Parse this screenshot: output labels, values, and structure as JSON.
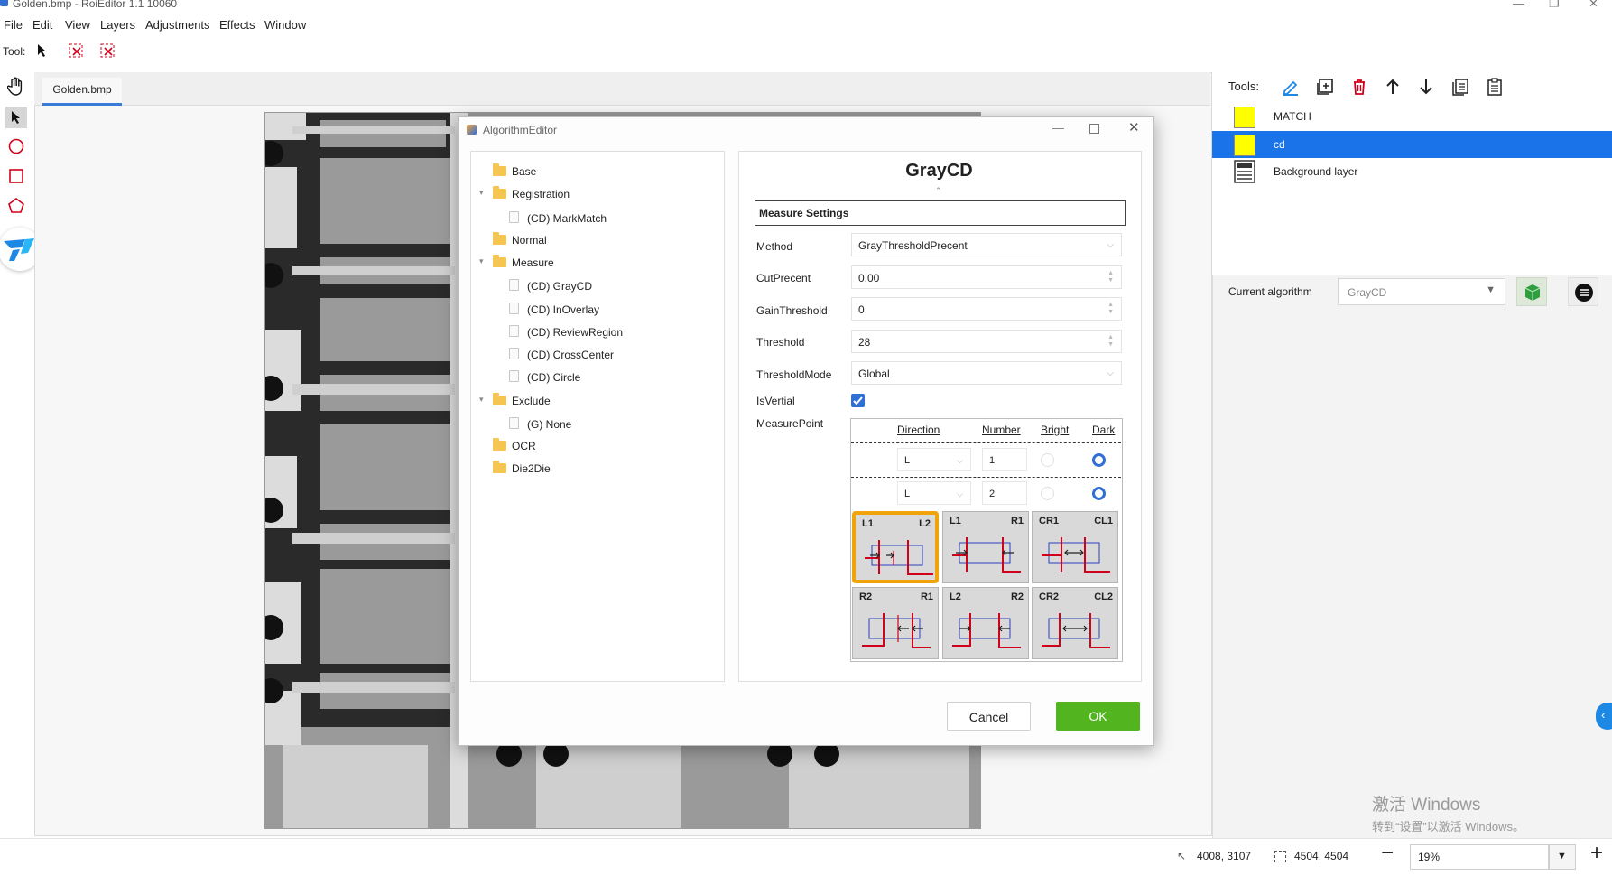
{
  "window": {
    "title": "Golden.bmp - RoiEditor 1.1 10060"
  },
  "menu": [
    "File",
    "Edit",
    "View",
    "Layers",
    "Adjustments",
    "Effects",
    "Window"
  ],
  "toolrow": {
    "label": "Tool:"
  },
  "document_tab": "Golden.bmp",
  "right_panel": {
    "tools_label": "Tools:",
    "layers": [
      {
        "name": "MATCH",
        "color": "#ffff00",
        "selected": false
      },
      {
        "name": "cd",
        "color": "#ffff00",
        "selected": true
      },
      {
        "name": "Background layer",
        "color": "",
        "selected": false
      }
    ],
    "current_algorithm_label": "Current algorithm",
    "current_algorithm_value": "GrayCD",
    "selection_color": "#1a73e8"
  },
  "watermark": {
    "line1": "激活 Windows",
    "line2": "转到“设置”以激活 Windows。"
  },
  "status": {
    "cursor": "4008, 3107",
    "size": "4504, 4504",
    "zoom": "19%"
  },
  "dialog": {
    "title": "AlgorithmEditor",
    "tree": [
      {
        "label": "Base",
        "type": "folder",
        "level": 0
      },
      {
        "label": "Registration",
        "type": "folder",
        "level": 0,
        "expanded": true
      },
      {
        "label": "(CD) MarkMatch",
        "type": "item",
        "level": 1
      },
      {
        "label": "Normal",
        "type": "folder",
        "level": 0
      },
      {
        "label": "Measure",
        "type": "folder",
        "level": 0,
        "expanded": true
      },
      {
        "label": "(CD) GrayCD",
        "type": "item",
        "level": 1
      },
      {
        "label": "(CD) InOverlay",
        "type": "item",
        "level": 1
      },
      {
        "label": "(CD) ReviewRegion",
        "type": "item",
        "level": 1
      },
      {
        "label": "(CD) CrossCenter",
        "type": "item",
        "level": 1
      },
      {
        "label": "(CD) Circle",
        "type": "item",
        "level": 1
      },
      {
        "label": "Exclude",
        "type": "folder",
        "level": 0,
        "expanded": true
      },
      {
        "label": "(G) None",
        "type": "item",
        "level": 1
      },
      {
        "label": "OCR",
        "type": "folder",
        "level": 0
      },
      {
        "label": "Die2Die",
        "type": "folder",
        "level": 0
      }
    ],
    "panel_title": "GrayCD",
    "section": "Measure Settings",
    "props": {
      "method": {
        "label": "Method",
        "value": "GrayThresholdPrecent"
      },
      "cutprecent": {
        "label": "CutPrecent",
        "value": "0.00"
      },
      "gainthreshold": {
        "label": "GainThreshold",
        "value": "0"
      },
      "threshold": {
        "label": "Threshold",
        "value": "28"
      },
      "thresholdmode": {
        "label": "ThresholdMode",
        "value": "Global"
      },
      "isvertial": {
        "label": "IsVertial",
        "checked": true
      },
      "measurepoint": {
        "label": "MeasurePoint"
      }
    },
    "measure_table": {
      "headers": [
        "Direction",
        "Number",
        "Bright",
        "Dark"
      ],
      "rows": [
        {
          "direction": "L",
          "number": "1",
          "bright": false,
          "dark": true
        },
        {
          "direction": "L",
          "number": "2",
          "bright": false,
          "dark": true
        }
      ]
    },
    "modes": [
      {
        "left": "L1",
        "right": "L2",
        "selected": true
      },
      {
        "left": "L1",
        "right": "R1",
        "selected": false
      },
      {
        "left": "CR1",
        "right": "CL1",
        "selected": false
      },
      {
        "left": "R2",
        "right": "R1",
        "selected": false
      },
      {
        "left": "L2",
        "right": "R2",
        "selected": false
      },
      {
        "left": "CR2",
        "right": "CL2",
        "selected": false
      }
    ],
    "cancel_label": "Cancel",
    "ok_label": "OK",
    "ok_color": "#52b51f"
  }
}
